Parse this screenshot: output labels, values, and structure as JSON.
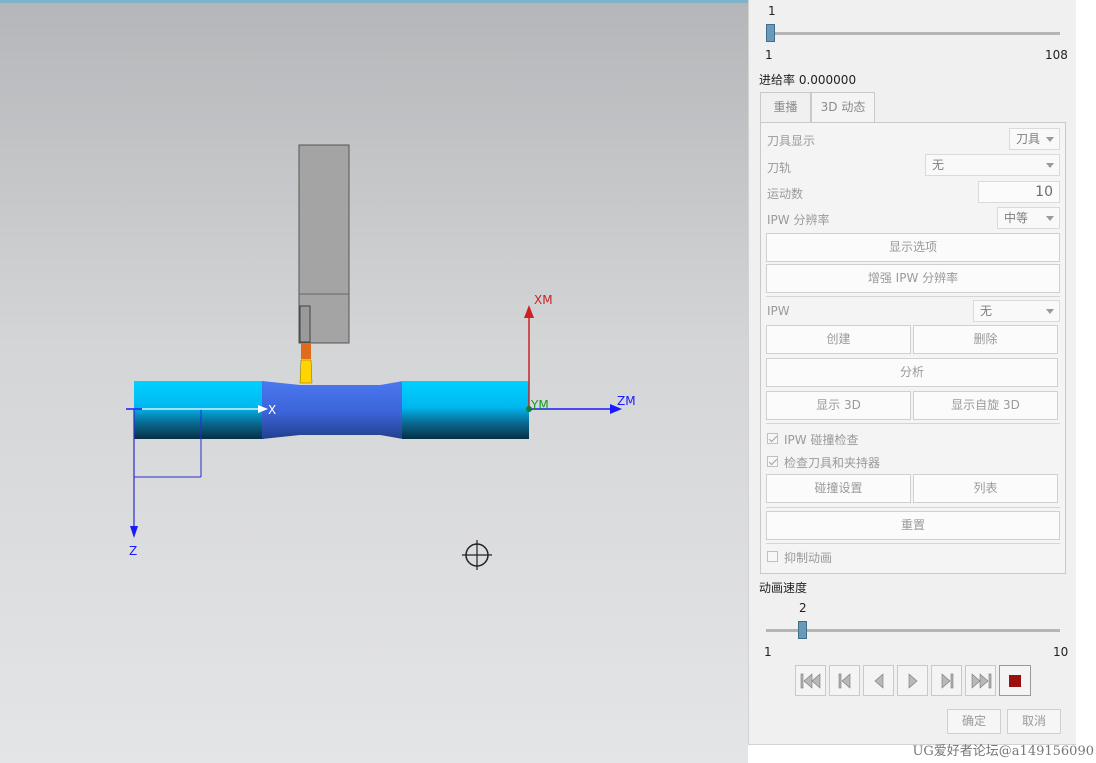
{
  "viewport": {
    "axis_labels": {
      "xm": "XM",
      "ym": "YM",
      "zm": "ZM",
      "x": "X",
      "z": "Z"
    },
    "colors": {
      "background_top": "#b4b6b9",
      "workpiece": "#00c8ff",
      "workpiece_machined": "#3f6fe8",
      "tool_holder": "#a4a4a4",
      "tool_insert": "#ffd400",
      "axis_red": "#cc2222",
      "axis_blue": "#1a1aff"
    }
  },
  "watermark": "UG爱好者论坛@a149156090",
  "dialog": {
    "motion_slider": {
      "current": "1",
      "min": "1",
      "max": "108",
      "value": 1
    },
    "feed_rate": "进给率 0.000000",
    "tabs": [
      {
        "label": "重播"
      },
      {
        "label": "3D 动态",
        "active": true
      }
    ],
    "tool_display": {
      "label": "刀具显示",
      "value": "刀具"
    },
    "tool_path": {
      "label": "刀轨",
      "value": "无"
    },
    "motion_count": {
      "label": "运动数",
      "value": "10"
    },
    "ipw_resolution": {
      "label": "IPW 分辨率",
      "value": "中等"
    },
    "show_options_button": "显示选项",
    "increase_ipw_button": "增强 IPW 分辨率",
    "ipw": {
      "label": "IPW",
      "value": "无"
    },
    "create_button": "创建",
    "delete_button": "删除",
    "analyze_button": "分析",
    "show_3d_button": "显示 3D",
    "show_spin_3d_button": "显示自旋 3D",
    "ipw_collision_check": {
      "label": "IPW 碰撞检查",
      "checked": true
    },
    "check_tool_holder": {
      "label": "检查刀具和夹持器",
      "checked": true
    },
    "collision_settings_button": "碰撞设置",
    "list_button": "列表",
    "reset_button": "重置",
    "suppress_animation": {
      "label": "抑制动画",
      "checked": false
    },
    "animation_speed": {
      "label": "动画速度",
      "current": "2",
      "min": "1",
      "max": "10",
      "value": 2
    },
    "playback_icons": [
      "skip-to-start-icon",
      "step-back-icon",
      "play-reverse-icon",
      "play-forward-icon",
      "step-forward-icon",
      "skip-to-end-icon",
      "stop-icon"
    ],
    "ok_button": "确定",
    "cancel_button": "取消"
  }
}
